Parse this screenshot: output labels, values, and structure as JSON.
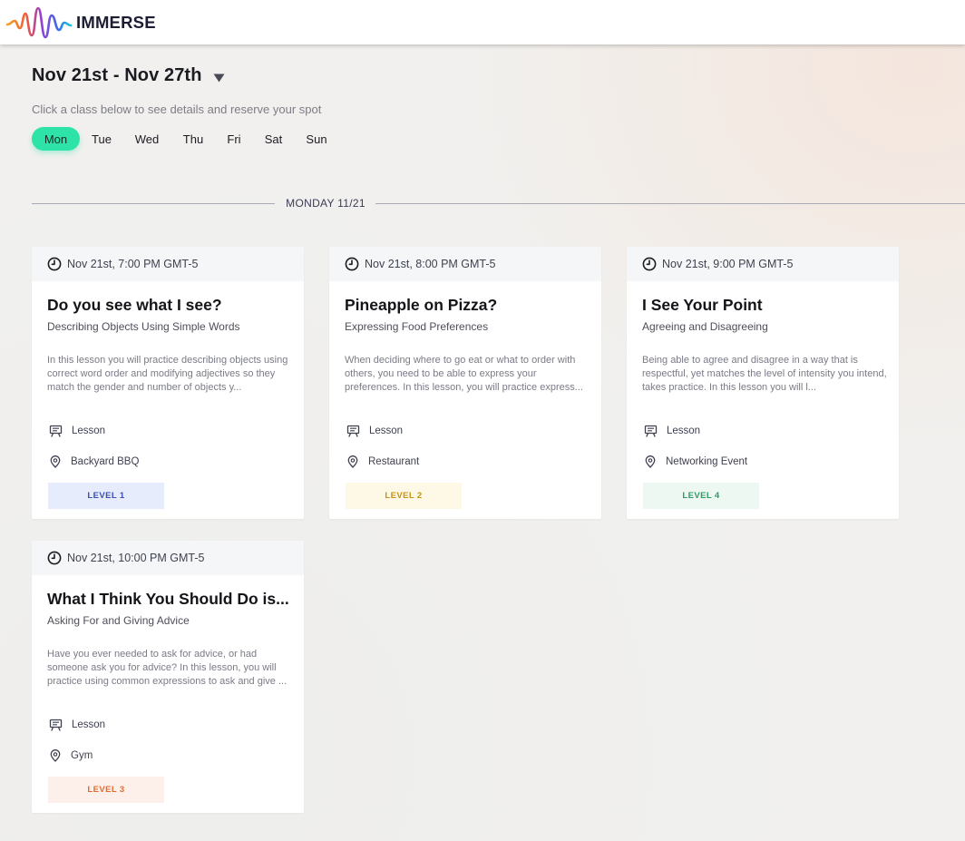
{
  "app": {
    "name": "IMMERSE"
  },
  "week": {
    "label": "Nov 21st - Nov 27th"
  },
  "instructions": "Click a class below to see details and reserve your spot",
  "days": [
    "Mon",
    "Tue",
    "Wed",
    "Thu",
    "Fri",
    "Sat",
    "Sun"
  ],
  "selected_day": "Mon",
  "section_label": "MONDAY 11/21",
  "cards": [
    {
      "time": "Nov 21st, 7:00 PM GMT-5",
      "title": "Do you see what I see?",
      "subtitle": "Describing Objects Using Simple Words",
      "description": "In this lesson you will practice describing objects using correct word order and modifying adjectives so they match the gender and number of objects y...",
      "type": "Lesson",
      "location": "Backyard BBQ",
      "level": "LEVEL 1",
      "level_bg": "#e6ecfc",
      "level_fg": "#3b4fb5"
    },
    {
      "time": "Nov 21st, 8:00 PM GMT-5",
      "title": "Pineapple on Pizza?",
      "subtitle": "Expressing Food Preferences",
      "description": "When deciding where to go eat or what to order with others, you need to be able to express your preferences. In this lesson, you will practice express...",
      "type": "Lesson",
      "location": "Restaurant",
      "level": "LEVEL 2",
      "level_bg": "#fdf9e6",
      "level_fg": "#c8940c"
    },
    {
      "time": "Nov 21st, 9:00 PM GMT-5",
      "title": "I See Your Point",
      "subtitle": "Agreeing and Disagreeing",
      "description": "Being able to agree and disagree in a way that is respectful, yet matches the level of intensity you intend, takes practice. In this lesson you will l...",
      "type": "Lesson",
      "location": "Networking Event",
      "level": "LEVEL 4",
      "level_bg": "#eef8f3",
      "level_fg": "#2b9b63"
    },
    {
      "time": "Nov 21st, 10:00 PM GMT-5",
      "title": "What I Think You Should Do is...",
      "subtitle": "Asking For and Giving Advice",
      "description": "Have you ever needed to ask for advice, or had someone ask you for advice? In this lesson, you will practice using common expressions to ask and give ...",
      "type": "Lesson",
      "location": "Gym",
      "level": "LEVEL 3",
      "level_bg": "#fdf0eb",
      "level_fg": "#e56a2a"
    }
  ],
  "colors": {
    "accent": "#2ee3a8",
    "text": "#1b1b22",
    "muted": "#7d7d85"
  }
}
